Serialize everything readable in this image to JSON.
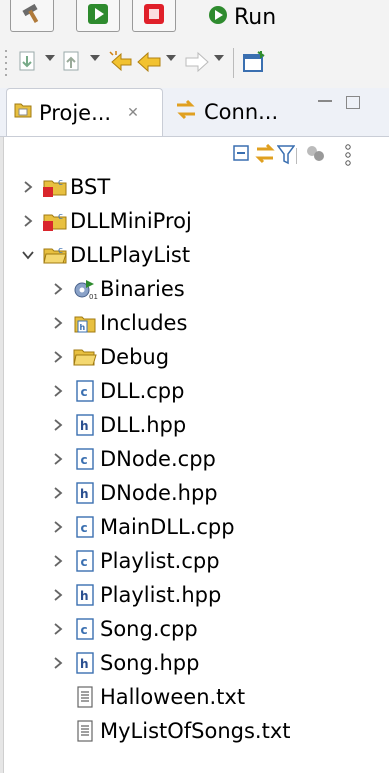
{
  "toolbar": {
    "run_label": "Run"
  },
  "view": {
    "tabs": [
      {
        "label": "Proje..."
      },
      {
        "label": "Conn..."
      }
    ]
  },
  "tree": {
    "items": [
      {
        "label": "BST",
        "icon": "cpp-project-icon",
        "expand": "collapsed"
      },
      {
        "label": "DLLMiniProj",
        "icon": "cpp-project-icon",
        "expand": "collapsed"
      },
      {
        "label": "DLLPlayList",
        "icon": "open-cpp-project-icon",
        "expand": "expanded"
      },
      {
        "label": "Binaries",
        "icon": "binaries-icon",
        "expand": "collapsed"
      },
      {
        "label": "Includes",
        "icon": "includes-icon",
        "expand": "collapsed"
      },
      {
        "label": "Debug",
        "icon": "folder-open-icon",
        "expand": "collapsed"
      },
      {
        "label": "DLL.cpp",
        "icon": "c-source-icon",
        "expand": "collapsed"
      },
      {
        "label": "DLL.hpp",
        "icon": "h-header-icon",
        "expand": "collapsed"
      },
      {
        "label": "DNode.cpp",
        "icon": "c-source-icon",
        "expand": "collapsed"
      },
      {
        "label": "DNode.hpp",
        "icon": "h-header-icon",
        "expand": "collapsed"
      },
      {
        "label": "MainDLL.cpp",
        "icon": "c-source-icon",
        "expand": "collapsed"
      },
      {
        "label": "Playlist.cpp",
        "icon": "c-source-icon",
        "expand": "collapsed"
      },
      {
        "label": "Playlist.hpp",
        "icon": "h-header-icon",
        "expand": "collapsed"
      },
      {
        "label": "Song.cpp",
        "icon": "c-source-icon",
        "expand": "collapsed"
      },
      {
        "label": "Song.hpp",
        "icon": "h-header-icon",
        "expand": "collapsed"
      },
      {
        "label": "Halloween.txt",
        "icon": "text-file-icon",
        "expand": "none"
      },
      {
        "label": "MyListOfSongs.txt",
        "icon": "text-file-icon",
        "expand": "none"
      }
    ]
  },
  "colors": {
    "run_green": "#2e8b2e",
    "stop_red": "#e0202a",
    "folder_yellow": "#e8c040",
    "icon_blue": "#3a6fb0",
    "tab_bg": "#eef1f7"
  }
}
